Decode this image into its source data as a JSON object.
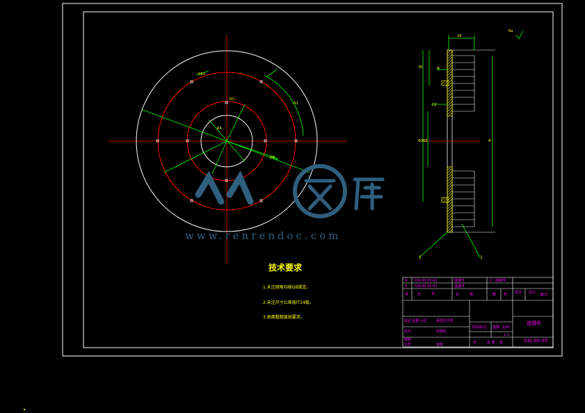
{
  "drawing": {
    "tech_req_title": "技术要求",
    "tech_reqs": [
      "1.未注倒角均按GB规定。",
      "2.未注尺寸公差按IT14级。",
      "3.表面粗糙度按要求。"
    ],
    "watermark_cn": "人人文库",
    "watermark_url": "www.renrendoc.com",
    "balloon_left": "2",
    "balloon_right": "1",
    "title_block": {
      "part_name": "连接件",
      "drawing_no": "XXJ-00-05",
      "scale": "1:1",
      "sheet": "共 张 第 张"
    }
  },
  "colors": {
    "frame": "#ffffff",
    "centerline": "#ff0000",
    "dimension": "#00ff00",
    "text": "#ffff00",
    "titleblock": "#ff00ff",
    "hatch": "#ffff00",
    "watermark": "#2f5f7f"
  }
}
